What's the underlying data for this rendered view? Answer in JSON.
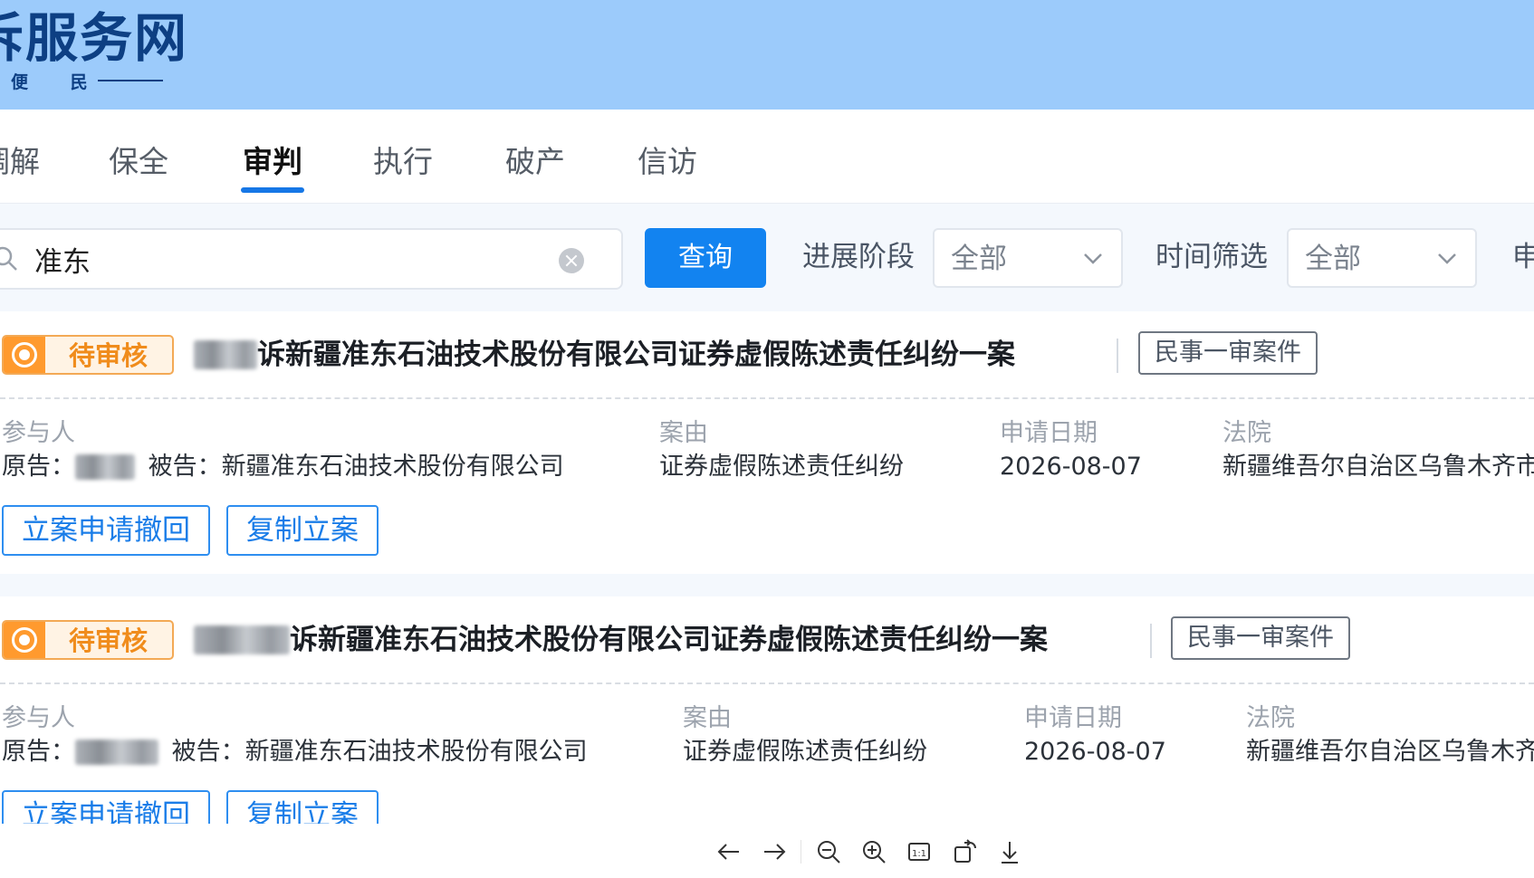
{
  "header": {
    "logo_title": "诉服务网",
    "logo_subtitle": "便 民"
  },
  "tabs": [
    {
      "label": "调解"
    },
    {
      "label": "保全"
    },
    {
      "label": "审判",
      "active": true
    },
    {
      "label": "执行"
    },
    {
      "label": "破产"
    },
    {
      "label": "信访"
    }
  ],
  "filters": {
    "search_value": "准东",
    "query_label": "查询",
    "stage_label": "进展阶段",
    "stage_value": "全部",
    "time_label": "时间筛选",
    "time_value": "全部",
    "extra_label": "申"
  },
  "cases": [
    {
      "status": "待审核",
      "title": "诉新疆准东石油技术股份有限公司证券虚假陈述责任纠纷一案",
      "type": "民事一审案件",
      "participant_label": "参与人",
      "plaintiff_prefix": "原告：",
      "defendant": "被告：新疆准东石油技术股份有限公司",
      "cause_label": "案由",
      "cause": "证券虚假陈述责任纠纷",
      "date_label": "申请日期",
      "date": "2026-08-07",
      "court_label": "法院",
      "court": "新疆维吾尔自治区乌鲁木齐市",
      "actions": [
        "立案申请撤回",
        "复制立案"
      ]
    },
    {
      "status": "待审核",
      "title": "诉新疆准东石油技术股份有限公司证券虚假陈述责任纠纷一案",
      "type": "民事一审案件",
      "participant_label": "参与人",
      "plaintiff_prefix": "原告：",
      "defendant": "被告：新疆准东石油技术股份有限公司",
      "cause_label": "案由",
      "cause": "证券虚假陈述责任纠纷",
      "date_label": "申请日期",
      "date": "2026-08-07",
      "court_label": "法院",
      "court": "新疆维吾尔自治区乌鲁木齐",
      "actions": [
        "立案申请撤回",
        "复制立案"
      ]
    }
  ],
  "viewer_toolbar": [
    {
      "icon": "arrow-left-icon"
    },
    {
      "icon": "arrow-right-icon"
    },
    {
      "icon": "zoom-out-icon"
    },
    {
      "icon": "zoom-in-icon"
    },
    {
      "icon": "actual-size-icon"
    },
    {
      "icon": "rotate-icon"
    },
    {
      "icon": "download-icon"
    }
  ],
  "colors": {
    "banner": "#9ccbfb",
    "accent": "#1283f0",
    "status_orange": "#ff9a2e",
    "page_bg": "#f4f8fd"
  }
}
